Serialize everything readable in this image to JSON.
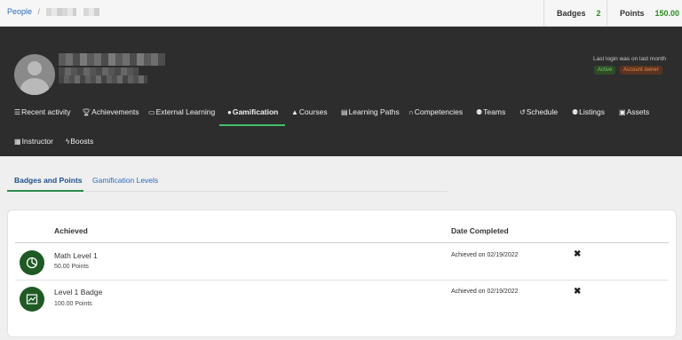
{
  "breadcrumb": {
    "root": "People",
    "separator": "/"
  },
  "stats": {
    "badges_label": "Badges",
    "badges_value": "2",
    "points_label": "Points",
    "points_value": "150.00"
  },
  "profile": {
    "last_login": "Last login was on last month",
    "status_active": "Active",
    "status_owner": "Account owner"
  },
  "nav": {
    "items": [
      {
        "label": "Recent activity",
        "icon": "list-icon"
      },
      {
        "label": "Achievements",
        "icon": "trophy-icon"
      },
      {
        "label": "External Learning",
        "icon": "laptop-icon"
      },
      {
        "label": "Gamification",
        "icon": "puzzle-icon"
      },
      {
        "label": "Courses",
        "icon": "graduation-cap-icon"
      },
      {
        "label": "Learning Paths",
        "icon": "book-icon"
      },
      {
        "label": "Competencies",
        "icon": "brain-icon"
      },
      {
        "label": "Teams",
        "icon": "users-icon"
      },
      {
        "label": "Schedule",
        "icon": "history-icon"
      },
      {
        "label": "Listings",
        "icon": "users-icon"
      },
      {
        "label": "Assets",
        "icon": "file-icon"
      },
      {
        "label": "Instructor",
        "icon": "calendar-icon"
      },
      {
        "label": "Boosts",
        "icon": "bolt-icon"
      }
    ],
    "active": "Gamification"
  },
  "tabs": {
    "items": [
      {
        "label": "Badges and Points"
      },
      {
        "label": "Gamification Levels"
      }
    ],
    "active": "Badges and Points"
  },
  "table": {
    "columns": {
      "achieved": "Achieved",
      "date": "Date Completed"
    },
    "rows": [
      {
        "title": "Math Level 1",
        "points": "50.00 Points",
        "date": "Achieved on 02/19/2022",
        "icon": "pie-chart-icon",
        "remove": "✖"
      },
      {
        "title": "Level 1 Badge",
        "points": "100.00 Points",
        "date": "Achieved on 02/19/2022",
        "icon": "line-chart-icon",
        "remove": "✖"
      }
    ]
  },
  "colors": {
    "accent_green": "#2e8b22",
    "header_bg": "#2d2d2d",
    "link_blue": "#2b6cb8",
    "badge_bg": "#1f5a25"
  }
}
